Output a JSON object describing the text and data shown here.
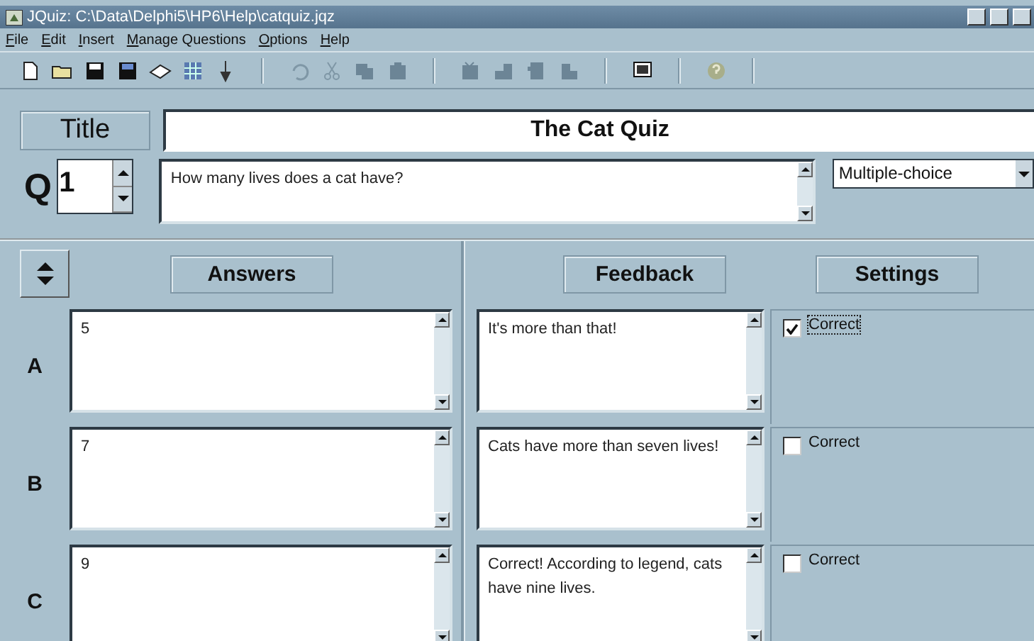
{
  "window": {
    "title": "JQuiz: C:\\Data\\Delphi5\\HP6\\Help\\catquiz.jqz"
  },
  "menu": [
    "File",
    "Edit",
    "Insert",
    "Manage Questions",
    "Options",
    "Help"
  ],
  "title_label": "Title",
  "quiz_title": "The Cat Quiz",
  "question": {
    "label": "Q",
    "number": "1",
    "text": "How many lives does a cat have?",
    "type": "Multiple-choice"
  },
  "headers": {
    "answers": "Answers",
    "feedback": "Feedback",
    "settings": "Settings"
  },
  "answers": [
    {
      "letter": "A",
      "answer": "5",
      "feedback": "It's more than that!",
      "correct_label": "Correct",
      "checked": true,
      "focused": true
    },
    {
      "letter": "B",
      "answer": "7",
      "feedback": "Cats  have more than seven lives!",
      "correct_label": "Correct",
      "checked": false,
      "focused": false
    },
    {
      "letter": "C",
      "answer": "9",
      "feedback": "Correct! According to legend, cats have nine lives.",
      "correct_label": "Correct",
      "checked": false,
      "focused": false
    }
  ]
}
